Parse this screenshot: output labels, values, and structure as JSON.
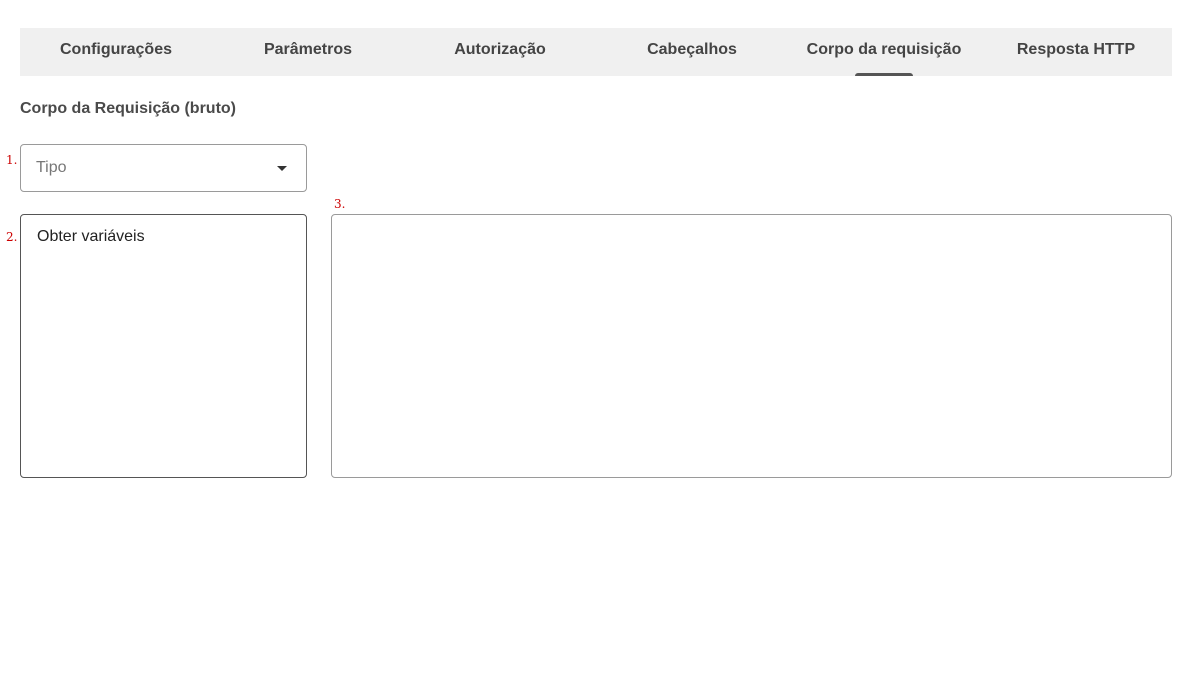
{
  "tabs": [
    {
      "label": "Configurações",
      "active": false
    },
    {
      "label": "Parâmetros",
      "active": false
    },
    {
      "label": "Autorização",
      "active": false
    },
    {
      "label": "Cabeçalhos",
      "active": false
    },
    {
      "label": "Corpo da requisição",
      "active": true
    },
    {
      "label": "Resposta HTTP",
      "active": false
    }
  ],
  "section": {
    "title": "Corpo da Requisição (bruto)"
  },
  "markers": [
    "1.",
    "2.",
    "3."
  ],
  "type_select": {
    "placeholder": "Tipo",
    "value": "",
    "icon": "arrow-drop-down-icon"
  },
  "variables": {
    "label": "Obter variáveis"
  },
  "body_editor": {
    "value": "",
    "placeholder": ""
  },
  "colors": {
    "tab_bar_bg": "#f0f0f0",
    "active_indicator": "#555555",
    "marker": "#cc0000"
  }
}
